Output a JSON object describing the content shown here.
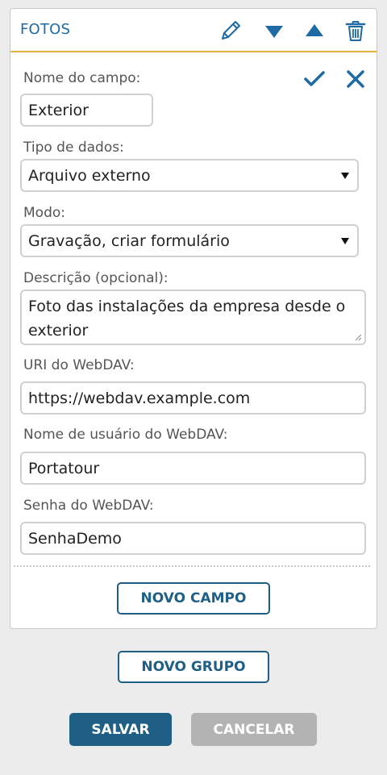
{
  "group": {
    "title": "FOTOS",
    "icons": [
      "pencil-icon",
      "move-down-icon",
      "move-up-icon",
      "trash-icon"
    ]
  },
  "field_form": {
    "name_label": "Nome do campo:",
    "name_value": "Exterior",
    "confirm_icon": "check-icon",
    "cancel_icon": "close-icon",
    "type_label": "Tipo de dados:",
    "type_value": "Arquivo externo",
    "mode_label": "Modo:",
    "mode_value": "Gravação, criar formulário",
    "description_label": "Descrição (opcional):",
    "description_value": "Foto das instalações da empresa desde o exterior",
    "uri_label": "URI do WebDAV:",
    "uri_value": "https://webdav.example.com",
    "user_label": "Nome de usuário do WebDAV:",
    "user_value": "Portatour",
    "password_label": "Senha do WebDAV:",
    "password_value": "SenhaDemo"
  },
  "actions": {
    "new_field": "NOVO CAMPO",
    "new_group": "NOVO GRUPO",
    "save": "SALVAR",
    "cancel": "CANCELAR"
  },
  "colors": {
    "accent": "#1d6aa5",
    "header_border": "#e2b53a",
    "primary_button": "#1f5f86",
    "disabled_button": "#b3b3b3"
  }
}
